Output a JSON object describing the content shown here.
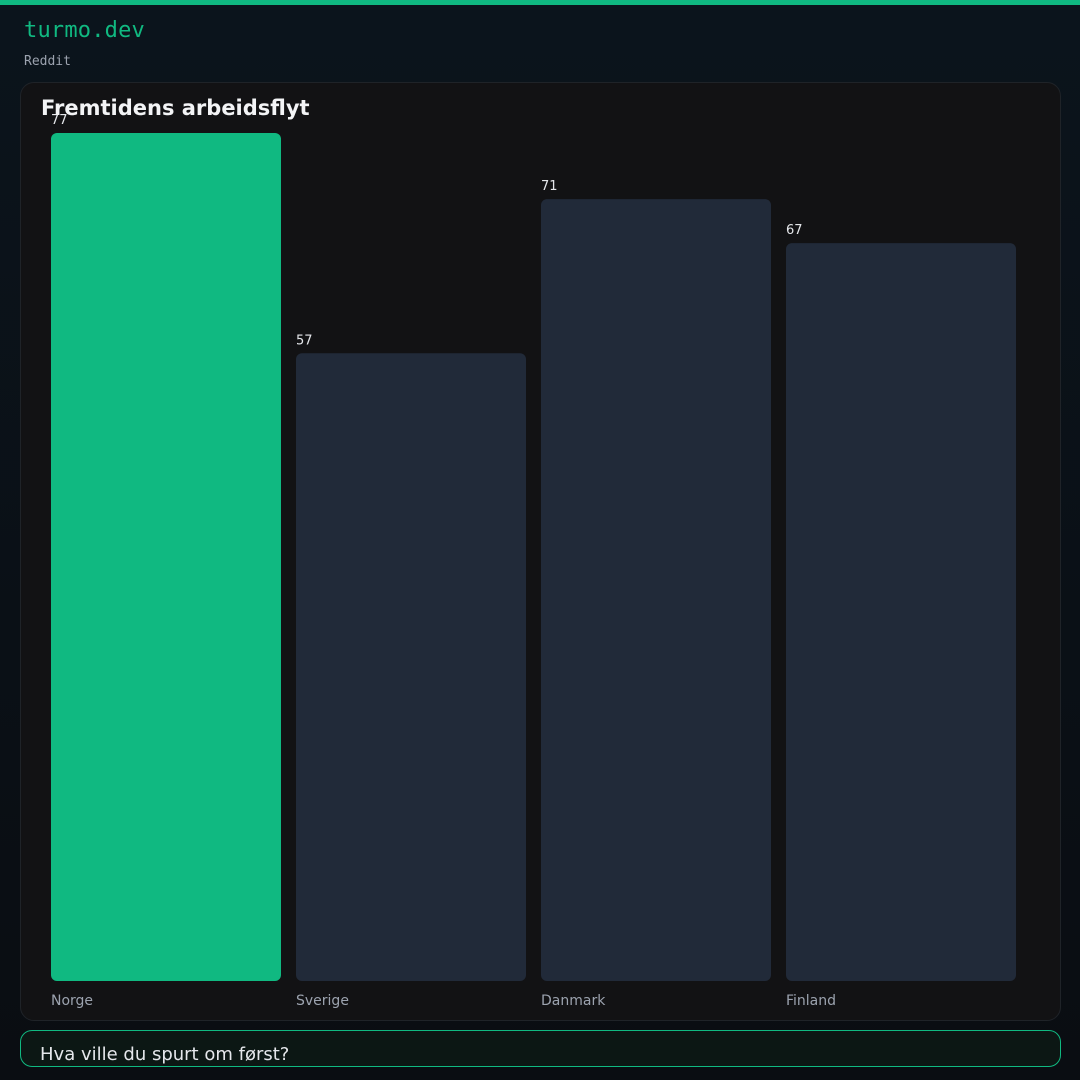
{
  "header": {
    "brand": "turmo.dev",
    "source": "Reddit"
  },
  "chart_data": {
    "type": "bar",
    "title": "Fremtidens arbeidsflyt",
    "categories": [
      "Norge",
      "Sverige",
      "Danmark",
      "Finland"
    ],
    "values": [
      77,
      57,
      71,
      67
    ],
    "ylim": [
      0,
      77
    ],
    "grid": false,
    "highlight_index": 0,
    "colors": {
      "highlight": "#10b981",
      "bar": "#212a39",
      "value_label": "#e5e7eb",
      "category_label": "#9ca3af"
    }
  },
  "footer": {
    "question": "Hva ville du spurt om først?"
  }
}
